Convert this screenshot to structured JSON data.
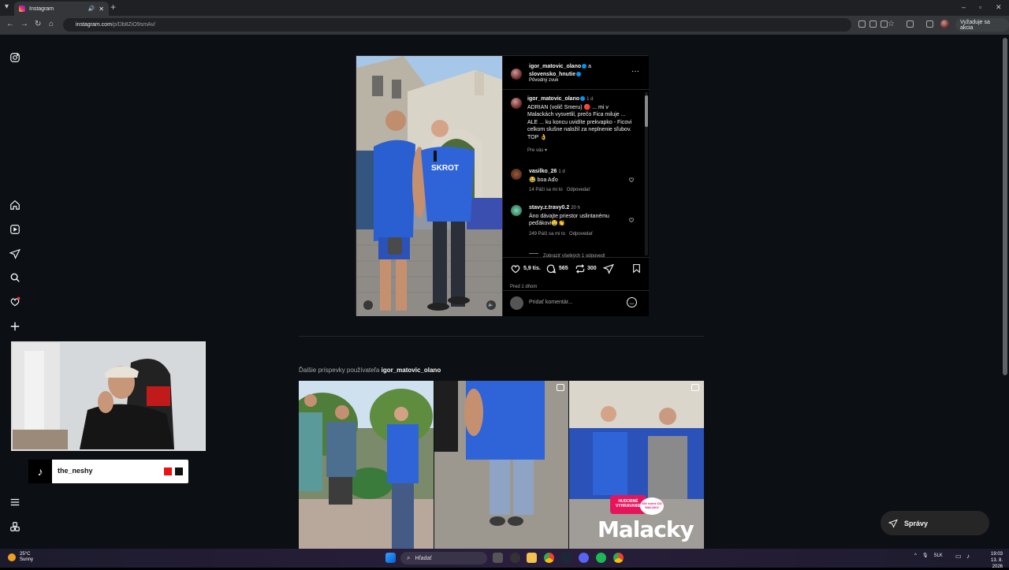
{
  "browser": {
    "tab_title": "Instagram",
    "new_tab": "+",
    "url_host": "instagram.com",
    "url_path": "/p/Db8ZiO9smAv/",
    "update_label": "Vyžaduje sa akcia"
  },
  "sidebar": {
    "items": [
      "instagram-logo",
      "home",
      "reels",
      "messages",
      "search",
      "notifications",
      "create",
      "menu",
      "threads"
    ]
  },
  "post": {
    "author1": "igor_matovic_olano",
    "connector": "a",
    "author2": "slovensko_hnutie",
    "audio": "Pôvodný zvuk",
    "caption": {
      "username": "igor_matovic_olano",
      "time": "1 d",
      "text": "ADRIAN (volič Smeru) 🔴 ... mi v Malackách vysvetlil, prečo Fica miluje ... ALE ... ku koncu uvidíte prekvapko - Ficovi celkom slušne naložil za neplnenie sľubov. TOP 👌",
      "translate": "Pre vás"
    },
    "comments": [
      {
        "username": "vasilko_26",
        "time": "1 d",
        "text": "😂 boa Aďo",
        "likes": "14 Páči sa mi to",
        "reply": "Odpovedať"
      },
      {
        "username": "stavy.z.travy0.2",
        "time": "20 h",
        "text": "Áno dávajte priestor uslintanému peďákovi🤤👏",
        "likes": "249 Páči sa mi to",
        "reply": "Odpovedať"
      }
    ],
    "view_replies": "Zobraziť všetkých 1 odpovedí",
    "likes_count": "5,9 tis.",
    "comments_count": "565",
    "reposts_count": "300",
    "posted": "Pred 1 dňom",
    "comment_placeholder": "Pridať komentár..."
  },
  "more_posts": {
    "prefix": "Ďalšie príspevky používateľa",
    "username": "igor_matovic_olano"
  },
  "grid_tiles": [
    {
      "caption": ""
    },
    {
      "caption": ""
    },
    {
      "caption": "Malacky",
      "badge": "200 ročné DO MALAKU",
      "stamp": "HUDOBNÉ VYHRAVANIE"
    }
  ],
  "webcam_overlay": {
    "platform": "TikTok",
    "name": "the_neshy"
  },
  "messages_button": "Správy",
  "taskbar": {
    "weather_temp": "25°C",
    "weather_desc": "Sunny",
    "search_placeholder": "Hľadať",
    "lang": "SLK",
    "time": "19:03",
    "date": "13. 8. 2026"
  },
  "colors": {
    "ig_bg": "#0c1014",
    "verified": "#0095f6",
    "shirt_blue": "#2a5fd1"
  }
}
